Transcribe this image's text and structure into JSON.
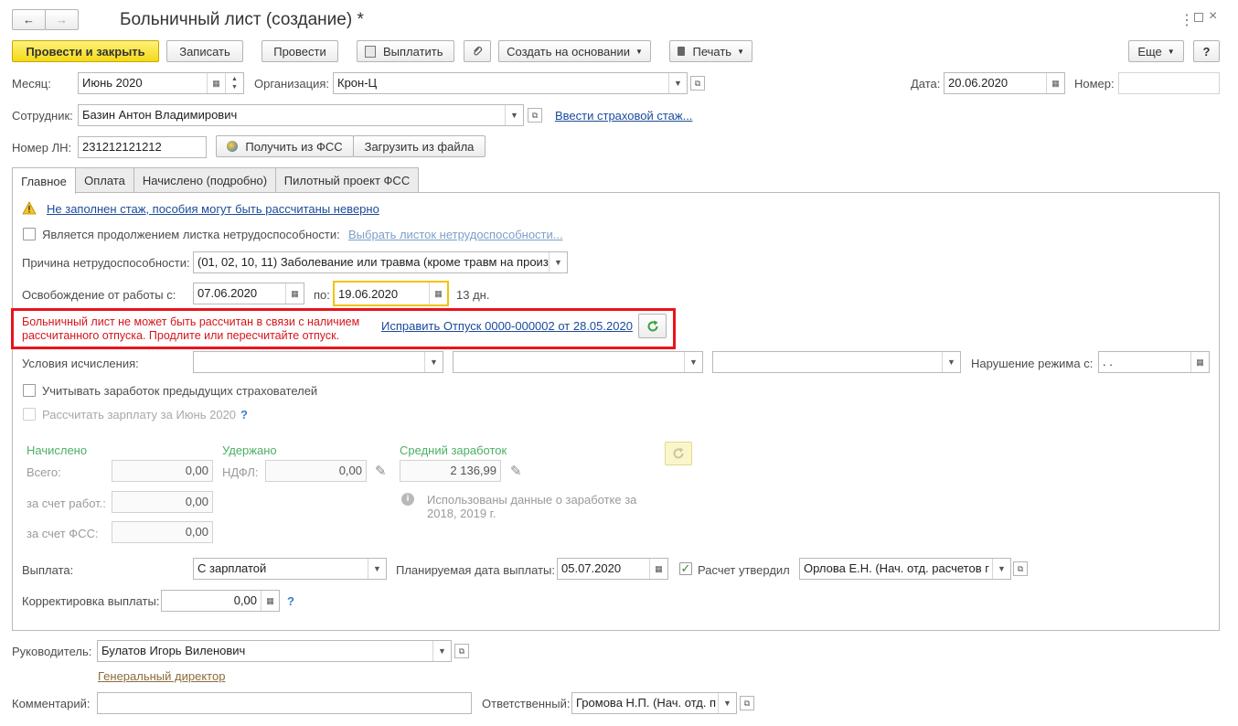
{
  "window": {
    "title": "Больничный лист (создание) *",
    "nav_back": "←",
    "nav_forward": "→"
  },
  "toolbar": {
    "post_close": "Провести и закрыть",
    "save": "Записать",
    "post": "Провести",
    "pay": "Выплатить",
    "create_based": "Создать на основании",
    "print": "Печать",
    "more": "Еще",
    "help": "?"
  },
  "header": {
    "month_label": "Месяц:",
    "month_value": "Июнь 2020",
    "org_label": "Организация:",
    "org_value": "Крон-Ц",
    "date_label": "Дата:",
    "date_value": "20.06.2020",
    "number_label": "Номер:",
    "number_value": "",
    "employee_label": "Сотрудник:",
    "employee_value": "Базин Антон Владимирович",
    "insurance_link": "Ввести страховой стаж...",
    "ln_label": "Номер ЛН:",
    "ln_value": "231212121212",
    "get_fss": "Получить из ФСС",
    "load_file": "Загрузить из файла"
  },
  "tabs": [
    "Главное",
    "Оплата",
    "Начислено (подробно)",
    "Пилотный проект ФСС"
  ],
  "main": {
    "warning_link": "Не заполнен стаж, пособия могут быть рассчитаны неверно",
    "continuation_label": "Является продолжением листка нетрудоспособности:",
    "choose_sheet_link": "Выбрать листок нетрудоспособности...",
    "reason_label": "Причина нетрудоспособности:",
    "reason_value": "(01, 02, 10, 11) Заболевание или травма (кроме травм на произв",
    "release_label": "Освобождение от работы с:",
    "release_from": "07.06.2020",
    "to_label": "по:",
    "release_to": "19.06.2020",
    "days": "13 дн.",
    "error_text_1": "Больничный лист не может быть рассчитан в связи с наличием",
    "error_text_2": "рассчитанного отпуска. Продлите или пересчитайте отпуск.",
    "fix_link": "Исправить Отпуск 0000-000002 от 28.05.2020",
    "conditions_label": "Условия исчисления:",
    "violation_label": "Нарушение режима с:",
    "violation_value": " .  .",
    "prev_insurers_label": "Учитывать заработок предыдущих страхователей",
    "calc_salary_label": "Рассчитать зарплату за Июнь 2020",
    "help_q": "?",
    "accrued_head": "Начислено",
    "total_label": "Всего:",
    "total_value": "0,00",
    "employer_label": "за счет работ.:",
    "employer_value": "0,00",
    "fss_label": "за счет ФСС:",
    "fss_value": "0,00",
    "withheld_head": "Удержано",
    "ndfl_label": "НДФЛ:",
    "ndfl_value": "0,00",
    "avg_head": "Средний заработок",
    "avg_value": "2 136,99",
    "used_data_1": "Использованы данные о заработке за",
    "used_data_2": "2018,  2019 г.",
    "payment_label": "Выплата:",
    "payment_value": "С зарплатой",
    "planned_date_label": "Планируемая дата выплаты:",
    "planned_date_value": "05.07.2020",
    "approved_label": "Расчет утвердил",
    "approved_value": "Орлова Е.Н. (Нач. отд. расчетов г",
    "correction_label": "Корректировка выплаты:",
    "correction_value": "0,00"
  },
  "footer": {
    "manager_label": "Руководитель:",
    "manager_value": "Булатов Игорь Виленович",
    "manager_position": "Генеральный директор",
    "comment_label": "Комментарий:",
    "comment_value": "",
    "responsible_label": "Ответственный:",
    "responsible_value": "Громова Н.П. (Нач. отд. п"
  },
  "colors": {
    "primary_button": "#f4d918",
    "error_border": "#e8141c",
    "error_text": "#d6141c",
    "link": "#1b4a9c",
    "section_head": "#4caf64"
  }
}
